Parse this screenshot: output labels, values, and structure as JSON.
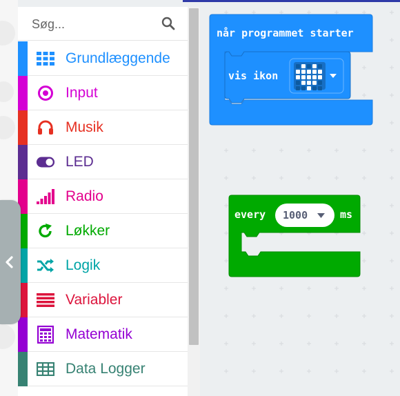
{
  "search": {
    "placeholder": "Søg..."
  },
  "categories": [
    {
      "label": "Grundlæggende",
      "color": "#1e90ff",
      "icon": "grid-icon"
    },
    {
      "label": "Input",
      "color": "#d400d4",
      "icon": "input-target-icon"
    },
    {
      "label": "Musik",
      "color": "#e63022",
      "icon": "headphones-icon"
    },
    {
      "label": "LED",
      "color": "#5c2d91",
      "icon": "toggle-icon"
    },
    {
      "label": "Radio",
      "color": "#e3008c",
      "icon": "signal-bars-icon"
    },
    {
      "label": "Løkker",
      "color": "#00aa00",
      "icon": "loop-arrow-icon"
    },
    {
      "label": "Logik",
      "color": "#00a4a6",
      "icon": "shuffle-icon"
    },
    {
      "label": "Variabler",
      "color": "#dc143c",
      "icon": "list-lines-icon"
    },
    {
      "label": "Matematik",
      "color": "#9400d3",
      "icon": "calculator-icon"
    },
    {
      "label": "Data Logger",
      "color": "#378273",
      "icon": "table-icon"
    }
  ],
  "blocks": {
    "on_start": {
      "label": "når programmet starter",
      "color": "#1e90ff"
    },
    "show_icon": {
      "label": "vis ikon",
      "icon": "heart-led-icon",
      "dropdown": "chevron-down-icon"
    },
    "every": {
      "label": "every",
      "value": "1000",
      "unit": "ms",
      "color": "#00aa00"
    }
  }
}
